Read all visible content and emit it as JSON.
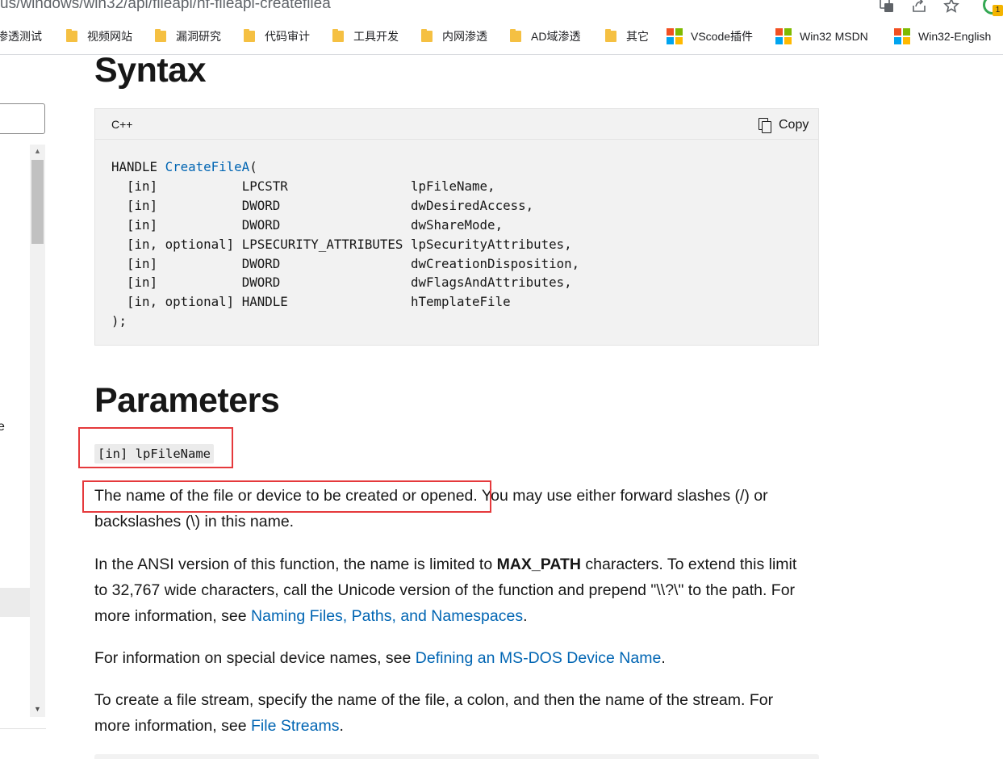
{
  "browser": {
    "url": "us/windows/win32/api/fileapi/nf-fileapi-createfilea",
    "icons": [
      "translate-icon",
      "share-icon",
      "star-icon"
    ],
    "profile_badge": "1",
    "bookmarks": [
      {
        "label": "渗透测试",
        "icon": "folder-icon"
      },
      {
        "label": "视频网站",
        "icon": "folder-icon"
      },
      {
        "label": "漏洞研究",
        "icon": "folder-icon"
      },
      {
        "label": "代码审计",
        "icon": "folder-icon"
      },
      {
        "label": "工具开发",
        "icon": "folder-icon"
      },
      {
        "label": "内网渗透",
        "icon": "folder-icon"
      },
      {
        "label": "AD域渗透",
        "icon": "folder-icon"
      },
      {
        "label": "其它",
        "icon": "folder-icon"
      },
      {
        "label": "VScode插件",
        "icon": "microsoft-logo-icon"
      },
      {
        "label": "Win32 MSDN",
        "icon": "microsoft-logo-icon"
      },
      {
        "label": "Win32-English",
        "icon": "microsoft-logo-icon"
      }
    ]
  },
  "nav": {
    "partial_glyph": "e",
    "scroll_up": "▲",
    "scroll_down": "▼"
  },
  "syntax": {
    "heading": "Syntax",
    "lang": "C++",
    "copy_label": "Copy",
    "code": {
      "return_type": "HANDLE ",
      "fn_name": "CreateFileA",
      "open": "(",
      "params": [
        {
          "dir": "[in]",
          "type": "LPCSTR",
          "name": "lpFileName,"
        },
        {
          "dir": "[in]",
          "type": "DWORD",
          "name": "dwDesiredAccess,"
        },
        {
          "dir": "[in]",
          "type": "DWORD",
          "name": "dwShareMode,"
        },
        {
          "dir": "[in, optional]",
          "type": "LPSECURITY_ATTRIBUTES",
          "name": "lpSecurityAttributes,"
        },
        {
          "dir": "[in]",
          "type": "DWORD",
          "name": "dwCreationDisposition,"
        },
        {
          "dir": "[in]",
          "type": "DWORD",
          "name": "dwFlagsAndAttributes,"
        },
        {
          "dir": "[in, optional]",
          "type": "HANDLE",
          "name": "hTemplateFile"
        }
      ],
      "close": ");"
    }
  },
  "parameters": {
    "heading": "Parameters",
    "param_name": "[in] lpFileName",
    "p1_highlight": "The name of the file or device to be created or opened.",
    "p1_rest": " You may use either forward slashes (/) or backslashes (\\) in this name.",
    "p2_a": "In the ANSI version of this function, the name is limited to ",
    "p2_bold": "MAX_PATH",
    "p2_b": " characters. To extend this limit to 32,767 wide characters, call the Unicode version of the function and prepend \"\\\\?\\\" to the path. For more information, see ",
    "p2_link": "Naming Files, Paths, and Namespaces",
    "p2_end": ".",
    "p3_a": "For information on special device names, see ",
    "p3_link": "Defining an MS-DOS Device Name",
    "p3_end": ".",
    "p4_a": "To create a file stream, specify the name of the file, a colon, and then the name of the stream. For more information, see ",
    "p4_link": "File Streams",
    "p4_end": "."
  },
  "colors": {
    "link": "#0065b3",
    "annotation_red": "#e5393c",
    "code_bg": "#f2f2f2"
  }
}
